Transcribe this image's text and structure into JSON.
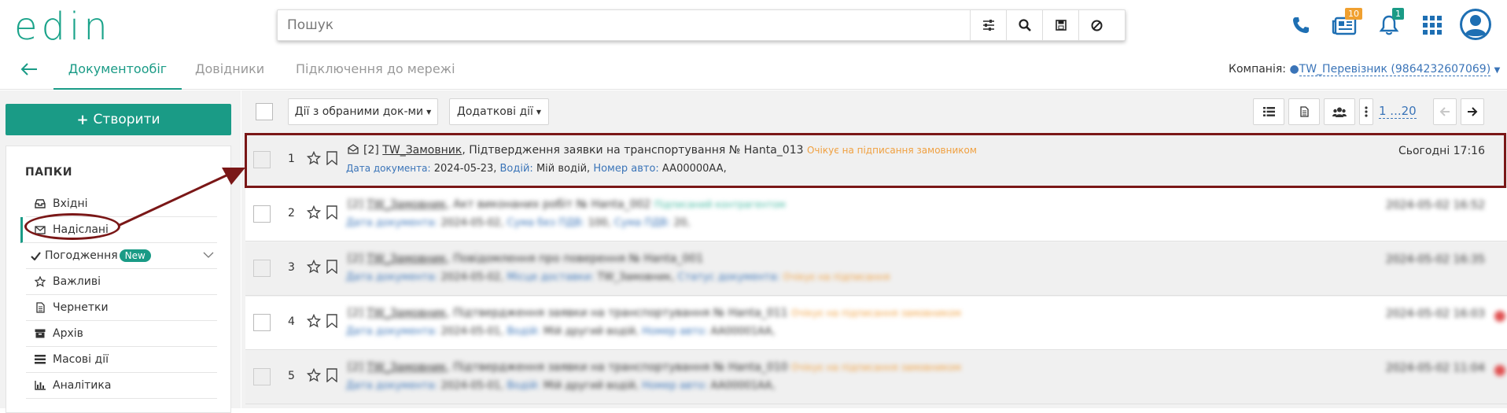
{
  "header": {
    "logo_text": "edin",
    "search_placeholder": "Пошук",
    "docs_badge": "10",
    "notif_badge": "1"
  },
  "nav": {
    "tabs": [
      "Документообіг",
      "Довідники",
      "Підключення до мережі"
    ],
    "company_label": "Компанія:",
    "company_value": "TW_Перевізник (9864232607069)"
  },
  "sidebar": {
    "create_label": "Створити",
    "folders_title": "ПАПКИ",
    "items": [
      {
        "label": "Вхідні",
        "icon": "inbox-icon"
      },
      {
        "label": "Надіслані",
        "icon": "envelope-icon"
      },
      {
        "label": "Погодження",
        "icon": "check-icon",
        "badge": "New"
      },
      {
        "label": "Важливі",
        "icon": "star-icon"
      },
      {
        "label": "Чернетки",
        "icon": "document-icon"
      },
      {
        "label": "Архів",
        "icon": "archive-icon"
      },
      {
        "label": "Масові дії",
        "icon": "list-icon"
      },
      {
        "label": "Аналітика",
        "icon": "chart-icon"
      }
    ]
  },
  "toolbar": {
    "bulk_actions": "Дії з обраними док-ми",
    "extra_actions": "Додаткові дії",
    "pagination": "1 ...20"
  },
  "rows": [
    {
      "num": "1",
      "title_prefix": "[2]",
      "sender": "TW_Замовник",
      "title": ", Підтвердження заявки на транспортування № Hanta_013",
      "status": "Очікує на підписання замовником",
      "date": "Сьогодні 17:16",
      "l2_date_label": "Дата документа:",
      "l2_date": "2024-05-23,",
      "l2_driver_label": "Водій:",
      "l2_driver": "Мій водій,",
      "l2_car_label": "Номер авто:",
      "l2_car": "AA00000AA,"
    },
    {
      "num": "2",
      "title_prefix": "[2]",
      "sender": "TW_Замовник",
      "title": ", Акт виконаних робіт № Hanta_002",
      "status": "Підписаний контрагентом",
      "date": "2024-05-02 16:52",
      "l2_date_label": "Дата документа:",
      "l2_date": "2024-05-02,",
      "l2_driver_label": "Сума без ПДВ:",
      "l2_driver": "100,",
      "l2_car_label": "Сума ПДВ:",
      "l2_car": "20,"
    },
    {
      "num": "3",
      "title_prefix": "[2]",
      "sender": "TW_Замовник",
      "title": ", Повідомлення про поверення № Hanta_001",
      "status": "",
      "date": "2024-05-02 16:35",
      "l2_date_label": "Дата документа:",
      "l2_date": "2024-05-02,",
      "l2_driver_label": "Місце доставки:",
      "l2_driver": "TW_Замовник,",
      "l2_car_label": "Статус документа:",
      "l2_car": "Очікує на підписання"
    },
    {
      "num": "4",
      "title_prefix": "[2]",
      "sender": "TW_Замовник",
      "title": ", Підтвердження заявки на транспортування № Hanta_011",
      "status": "Очікує на підписання замовником",
      "date": "2024-05-02 16:03",
      "l2_date_label": "Дата документа:",
      "l2_date": "2024-05-01,",
      "l2_driver_label": "Водій:",
      "l2_driver": "Мій другий водій,",
      "l2_car_label": "Номер авто:",
      "l2_car": "AA00001AA,"
    },
    {
      "num": "5",
      "title_prefix": "[2]",
      "sender": "TW_Замовник",
      "title": ", Підтвердження заявки на транспортування № Hanta_010",
      "status": "Очікує на підписання замовником",
      "date": "2024-05-02 11:04",
      "l2_date_label": "Дата документа:",
      "l2_date": "2024-05-01,",
      "l2_driver_label": "Водій:",
      "l2_driver": "Мій другий водій,",
      "l2_car_label": "Номер авто:",
      "l2_car": "AA00001AA,"
    }
  ],
  "colors": {
    "brand": "#1a9b86",
    "highlight": "#7a1717",
    "status_orange": "#f0a040",
    "label_blue": "#3a74b8"
  }
}
